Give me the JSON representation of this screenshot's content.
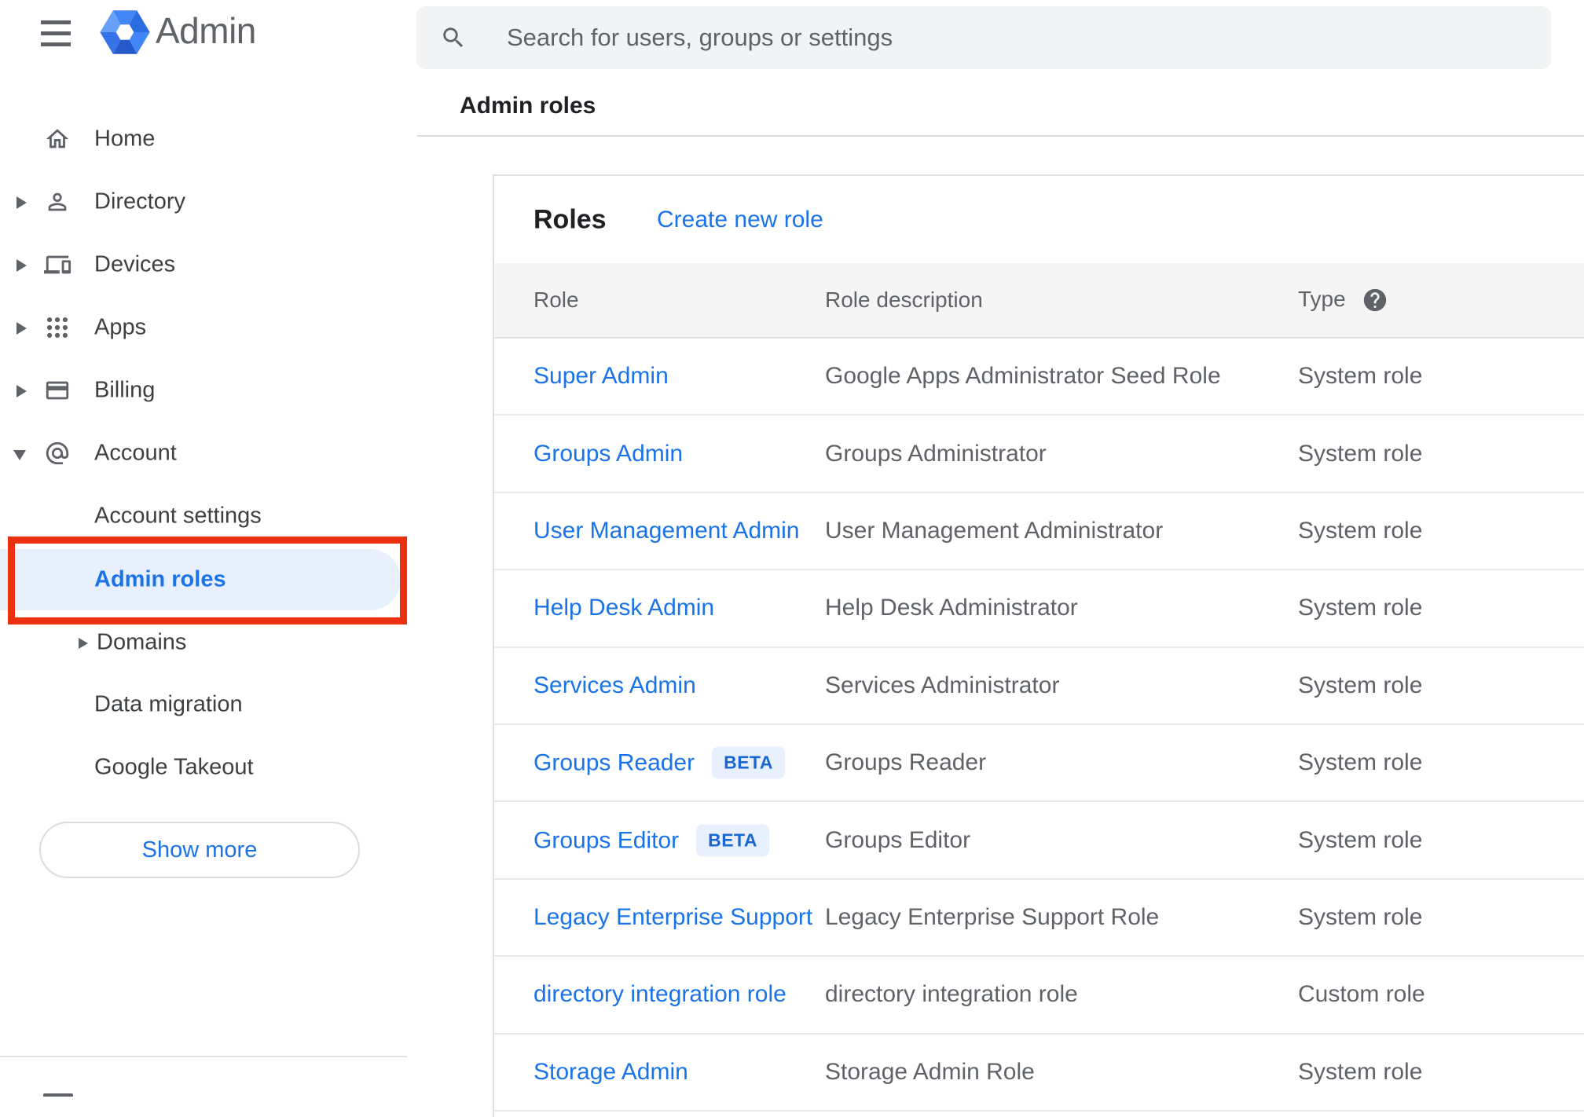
{
  "sidebar": {
    "logo": {
      "text": "Admin"
    },
    "items": [
      {
        "label": "Home"
      },
      {
        "label": "Directory"
      },
      {
        "label": "Devices"
      },
      {
        "label": "Apps"
      },
      {
        "label": "Billing"
      },
      {
        "label": "Account"
      }
    ],
    "account_children": [
      {
        "label": "Account settings"
      },
      {
        "label": "Admin roles",
        "selected": true
      },
      {
        "label": "Domains"
      },
      {
        "label": "Data migration"
      },
      {
        "label": "Google Takeout"
      }
    ],
    "show_more_label": "Show more"
  },
  "search": {
    "placeholder": "Search for users, groups or settings"
  },
  "breadcrumb": {
    "label": "Admin roles"
  },
  "roles_panel": {
    "title": "Roles",
    "create_link": "Create new role",
    "columns": {
      "role": "Role",
      "description": "Role description",
      "type": "Type"
    },
    "rows": [
      {
        "role": "Super Admin",
        "description": "Google Apps Administrator Seed Role",
        "type": "System role"
      },
      {
        "role": "Groups Admin",
        "description": "Groups Administrator",
        "type": "System role"
      },
      {
        "role": "User Management Admin",
        "description": "User Management Administrator",
        "type": "System role"
      },
      {
        "role": "Help Desk Admin",
        "description": "Help Desk Administrator",
        "type": "System role"
      },
      {
        "role": "Services Admin",
        "description": "Services Administrator",
        "type": "System role"
      },
      {
        "role": "Groups Reader",
        "badge": "BETA",
        "description": "Groups Reader",
        "type": "System role"
      },
      {
        "role": "Groups Editor",
        "badge": "BETA",
        "description": "Groups Editor",
        "type": "System role"
      },
      {
        "role": "Legacy Enterprise Support",
        "description": "Legacy Enterprise Support Role",
        "type": "System role"
      },
      {
        "role": "directory integration role",
        "description": "directory integration role",
        "type": "Custom role"
      },
      {
        "role": "Storage Admin",
        "description": "Storage Admin Role",
        "type": "System role"
      }
    ]
  },
  "colors": {
    "accent_blue": "#1a73e8",
    "selected_item_bg": "#e8f0fe",
    "annotation_red": "#ec3111",
    "badge_bg": "#e8f0fe",
    "badge_text": "#1967d2",
    "table_header_bg": "#f5f5f5"
  }
}
